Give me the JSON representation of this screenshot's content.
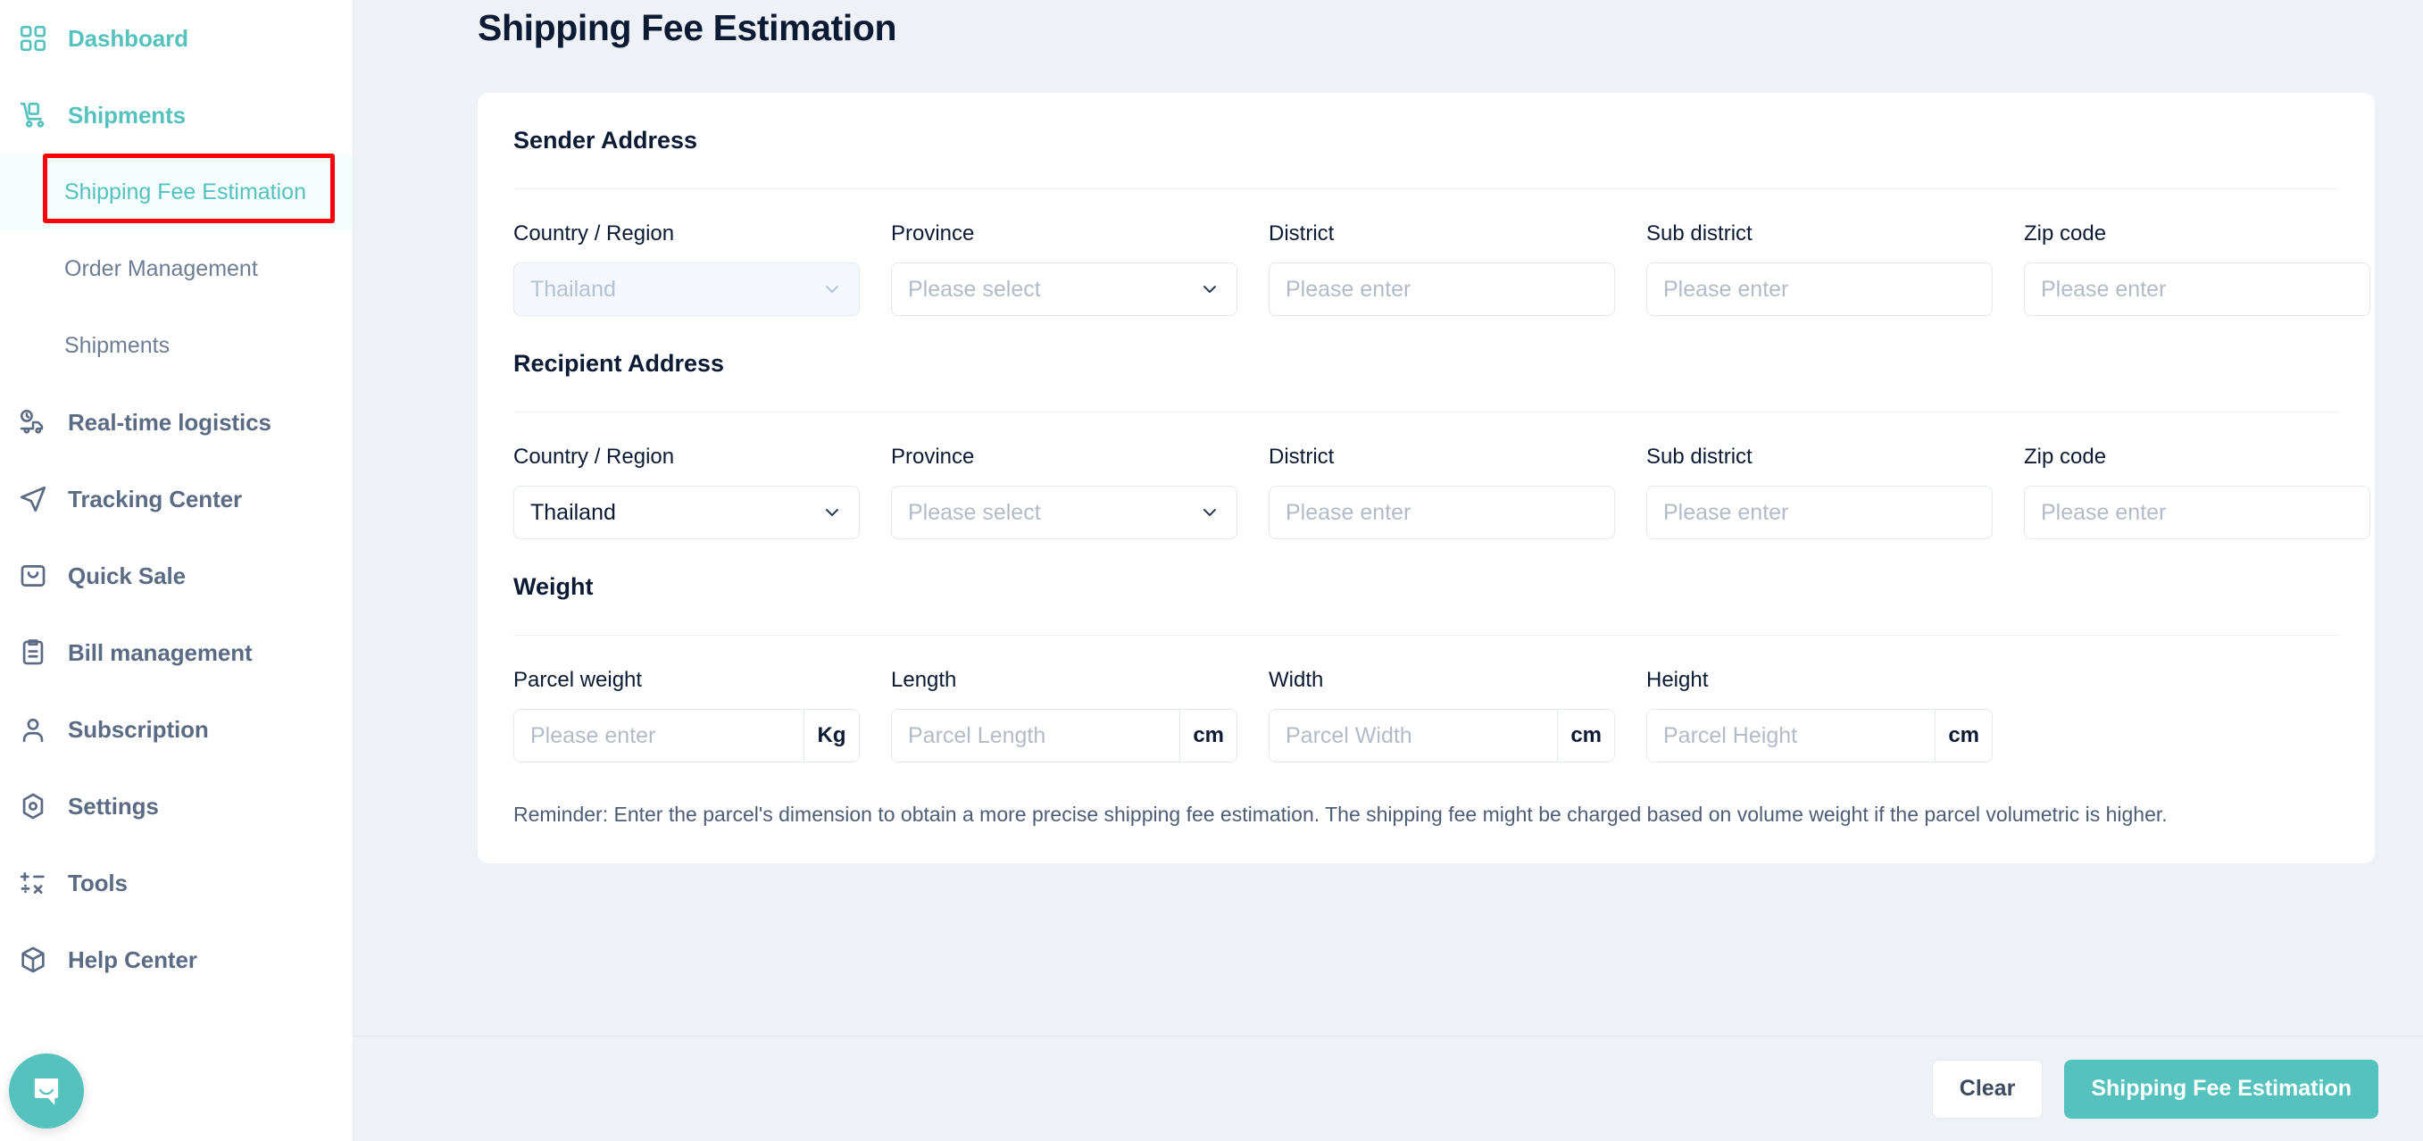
{
  "sidebar": {
    "items": [
      {
        "label": "Dashboard",
        "icon": "grid-icon",
        "active": true
      },
      {
        "label": "Shipments",
        "icon": "hand-truck-icon",
        "active": true
      },
      {
        "label": "Real-time logistics",
        "icon": "truck-clock-icon",
        "active": false
      },
      {
        "label": "Tracking Center",
        "icon": "paper-plane-icon",
        "active": false
      },
      {
        "label": "Quick Sale",
        "icon": "shopping-bag-icon",
        "active": false
      },
      {
        "label": "Bill management",
        "icon": "clipboard-icon",
        "active": false
      },
      {
        "label": "Subscription",
        "icon": "user-icon",
        "active": false
      },
      {
        "label": "Settings",
        "icon": "gear-icon",
        "active": false
      },
      {
        "label": "Tools",
        "icon": "calculator-icon",
        "active": false
      },
      {
        "label": "Help Center",
        "icon": "package-icon",
        "active": false
      }
    ],
    "sub_items": [
      {
        "label": "Shipping Fee Estimation",
        "selected": true
      },
      {
        "label": "Order Management",
        "selected": false
      },
      {
        "label": "Shipments",
        "selected": false
      }
    ],
    "chat_icon": "chat-bubble-icon"
  },
  "header": {
    "title": "Shipping Fee Estimation"
  },
  "sections": {
    "sender": {
      "title": "Sender Address",
      "fields": [
        {
          "label": "Country / Region",
          "type": "select",
          "value": "Thailand",
          "placeholder": "Please select",
          "disabled": true
        },
        {
          "label": "Province",
          "type": "select",
          "value": "",
          "placeholder": "Please select",
          "disabled": false
        },
        {
          "label": "District",
          "type": "input",
          "value": "",
          "placeholder": "Please enter",
          "disabled": false
        },
        {
          "label": "Sub district",
          "type": "input",
          "value": "",
          "placeholder": "Please enter",
          "disabled": false
        },
        {
          "label": "Zip code",
          "type": "input",
          "value": "",
          "placeholder": "Please enter",
          "disabled": false
        }
      ]
    },
    "recipient": {
      "title": "Recipient Address",
      "fields": [
        {
          "label": "Country / Region",
          "type": "select",
          "value": "Thailand",
          "placeholder": "Please select",
          "disabled": false
        },
        {
          "label": "Province",
          "type": "select",
          "value": "",
          "placeholder": "Please select",
          "disabled": false
        },
        {
          "label": "District",
          "type": "input",
          "value": "",
          "placeholder": "Please enter",
          "disabled": false
        },
        {
          "label": "Sub district",
          "type": "input",
          "value": "",
          "placeholder": "Please enter",
          "disabled": false
        },
        {
          "label": "Zip code",
          "type": "input",
          "value": "",
          "placeholder": "Please enter",
          "disabled": false
        }
      ]
    },
    "weight": {
      "title": "Weight",
      "fields": [
        {
          "label": "Parcel weight",
          "placeholder": "Please enter",
          "unit": "Kg"
        },
        {
          "label": "Length",
          "placeholder": "Parcel Length",
          "unit": "cm"
        },
        {
          "label": "Width",
          "placeholder": "Parcel Width",
          "unit": "cm"
        },
        {
          "label": "Height",
          "placeholder": "Parcel Height",
          "unit": "cm"
        }
      ],
      "reminder": "Reminder: Enter the parcel's dimension to obtain a more precise shipping fee estimation. The shipping fee might be charged based on volume weight if the parcel volumetric is higher."
    }
  },
  "footer": {
    "clear_label": "Clear",
    "submit_label": "Shipping Fee Estimation"
  },
  "colors": {
    "accent": "#55c2bd",
    "text_dark": "#0d1a33",
    "muted": "#6e7d93",
    "page_bg": "#eef1f5",
    "annotation": "#fb0007"
  }
}
